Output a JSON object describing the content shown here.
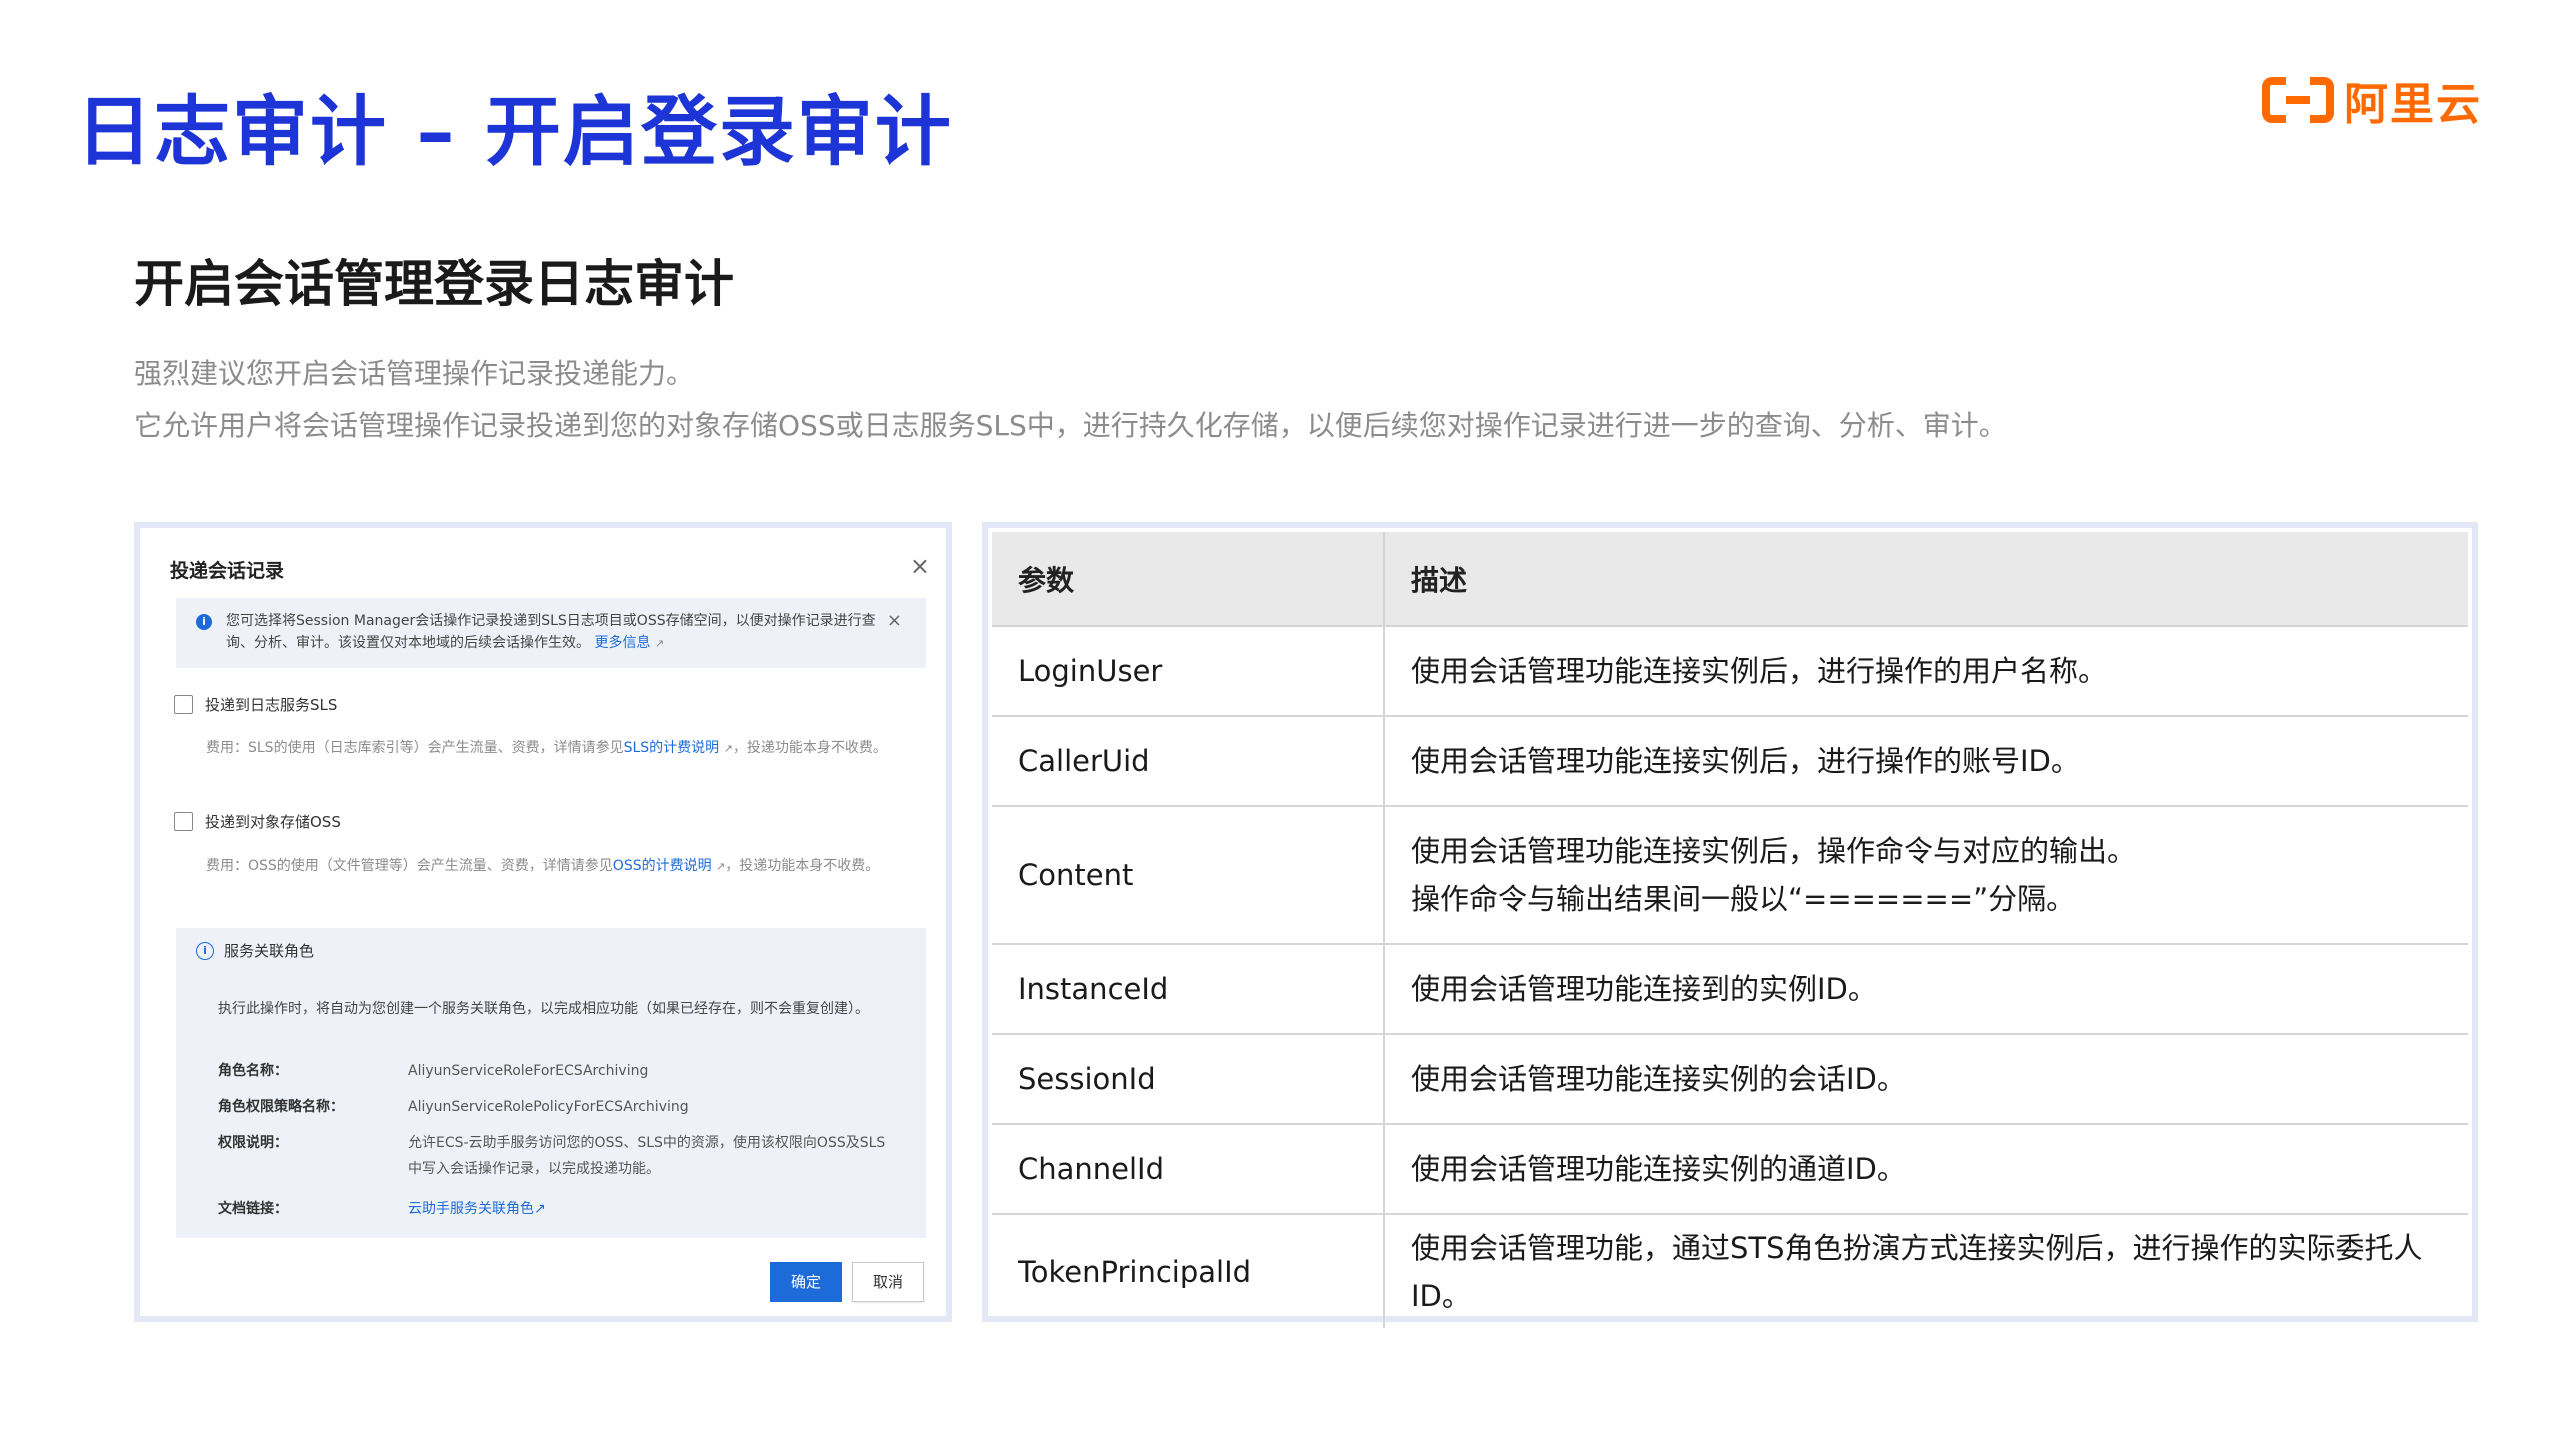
{
  "header": {
    "title": "日志审计 – 开启登录审计",
    "logo_text": "阿里云",
    "logo_color": "#ff6a00",
    "title_color": "#1d34d6"
  },
  "section": {
    "title": "开启会话管理登录日志审计",
    "desc_line1": "强烈建议您开启会话管理操作记录投递能力。",
    "desc_line2": "它允许用户将会话管理操作记录投递到您的对象存储OSS或日志服务SLS中，进行持久化存储，以便后续您对操作记录进行进一步的查询、分析、审计。"
  },
  "dialog": {
    "title": "投递会话记录",
    "close": "×",
    "notice_text": "您可选择将Session Manager会话操作记录投递到SLS日志项目或OSS存储空间，以便对操作记录进行查询、分析、审计。该设置仅对本地域的后续会话操作生效。",
    "notice_link": "更多信息",
    "notice_close": "×",
    "sls_label": "投递到日志服务SLS",
    "sls_fee_prefix": "费用：SLS的使用（日志库索引等）会产生流量、资费，详情请参见",
    "sls_fee_link": "SLS的计费说明",
    "sls_fee_suffix": "，投递功能本身不收费。",
    "oss_label": "投递到对象存储OSS",
    "oss_fee_prefix": "费用：OSS的使用（文件管理等）会产生流量、资费，详情请参见",
    "oss_fee_link": "OSS的计费说明",
    "oss_fee_suffix": "，投递功能本身不收费。",
    "role": {
      "heading": "服务关联角色",
      "intro": "执行此操作时，将自动为您创建一个服务关联角色，以完成相应功能（如果已经存在，则不会重复创建）。",
      "name_key": "角色名称：",
      "name_val": "AliyunServiceRoleForECSArchiving",
      "policy_key": "角色权限策略名称：",
      "policy_val": "AliyunServiceRolePolicyForECSArchiving",
      "perm_key": "权限说明：",
      "perm_val": "允许ECS-云助手服务访问您的OSS、SLS中的资源，使用该权限向OSS及SLS中写入会话操作记录，以完成投递功能。",
      "doc_key": "文档链接：",
      "doc_val": "云助手服务关联角色"
    },
    "ok_label": "确定",
    "cancel_label": "取消"
  },
  "table": {
    "headers": [
      "参数",
      "描述"
    ],
    "rows": [
      {
        "param": "LoginUser",
        "desc": "使用会话管理功能连接实例后，进行操作的用户名称。"
      },
      {
        "param": "CallerUid",
        "desc": "使用会话管理功能连接实例后，进行操作的账号ID。"
      },
      {
        "param": "Content",
        "desc": "使用会话管理功能连接实例后，操作命令与对应的输出。",
        "desc2": "操作命令与输出结果间一般以“=======”分隔。"
      },
      {
        "param": "InstanceId",
        "desc": "使用会话管理功能连接到的实例ID。"
      },
      {
        "param": "SessionId",
        "desc": "使用会话管理功能连接实例的会话ID。"
      },
      {
        "param": "ChannelId",
        "desc": "使用会话管理功能连接实例的通道ID。"
      },
      {
        "param": "TokenPrincipalId",
        "desc": "使用会话管理功能，通过STS角色扮演方式连接实例后，进行操作的实际委托人ID。"
      }
    ]
  }
}
